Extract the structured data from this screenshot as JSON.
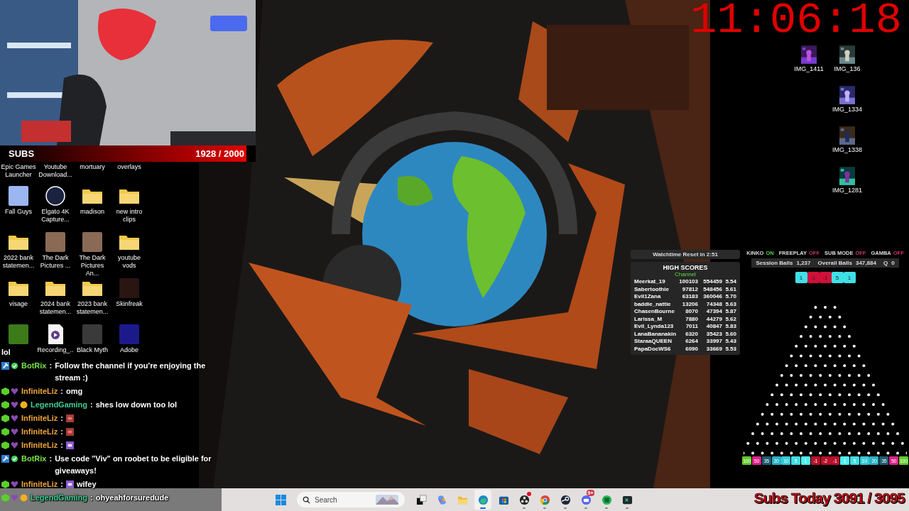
{
  "subs_goal": {
    "label": "SUBS",
    "count": "1928 / 2000",
    "level": 0.964
  },
  "desktop_icons": [
    {
      "label": "Epic Games Launcher",
      "kind": "hidden"
    },
    {
      "label": "Youtube Download...",
      "kind": "hidden"
    },
    {
      "label": "mortuary",
      "kind": "hidden"
    },
    {
      "label": "overlays",
      "kind": "hidden"
    },
    {
      "label": "Fall Guys",
      "kind": "app",
      "color": "#9bb6f0"
    },
    {
      "label": "Elgato 4K Capture...",
      "kind": "disc",
      "color": "#1a2340"
    },
    {
      "label": "madison",
      "kind": "folder"
    },
    {
      "label": "new intro clips",
      "kind": "folder"
    },
    {
      "label": "2022 bank statemen...",
      "kind": "folder"
    },
    {
      "label": "The Dark Pictures ...",
      "kind": "app",
      "color": "#8a6a55"
    },
    {
      "label": "The Dark Pictures An...",
      "kind": "app",
      "color": "#8a6a55"
    },
    {
      "label": "youtube vods",
      "kind": "folder"
    },
    {
      "label": "visage",
      "kind": "folder"
    },
    {
      "label": "2024 bank statemen...",
      "kind": "folder"
    },
    {
      "label": "2023 bank statemen...",
      "kind": "folder"
    },
    {
      "label": "Skinfreak",
      "kind": "app",
      "color": "#2a1512"
    },
    {
      "kind": "app",
      "color": "#3c7a1a"
    },
    {
      "label": "Recording_...",
      "kind": "file"
    },
    {
      "label": "Black Myth",
      "kind": "app",
      "color": "#3a3a3a"
    },
    {
      "label": "Adobe",
      "kind": "app",
      "color": "#1c1a8a"
    }
  ],
  "chat": [
    {
      "kind": "continuation",
      "message": "lol"
    },
    {
      "kind": "message",
      "user": "BotRix",
      "color": "#7be04a",
      "badges": [
        {
          "kind": "bot"
        },
        {
          "kind": "verified"
        }
      ],
      "separator": ":",
      "message": "Follow the channel if you're enjoying the stream :)"
    },
    {
      "kind": "message",
      "user": "InfiniteLiz",
      "color": "#f0a53a",
      "badges": [
        {
          "kind": "cube"
        },
        {
          "kind": "heart"
        }
      ],
      "separator": ":",
      "message": "omg"
    },
    {
      "kind": "message",
      "user": "LegendGaming",
      "color": "#3fcf95",
      "badges": [
        {
          "kind": "cube"
        },
        {
          "kind": "heart"
        },
        {
          "kind": "coin"
        }
      ],
      "separator": ":",
      "message": "shes low down too lol"
    },
    {
      "kind": "message",
      "user": "InfiniteLiz",
      "color": "#f0a53a",
      "badges": [
        {
          "kind": "cube"
        },
        {
          "kind": "heart"
        }
      ],
      "separator": ":",
      "emote": {
        "kind": "red"
      }
    },
    {
      "kind": "message",
      "user": "InfiniteLiz",
      "color": "#f0a53a",
      "badges": [
        {
          "kind": "cube"
        },
        {
          "kind": "heart"
        }
      ],
      "separator": ":",
      "emote": {
        "kind": "red"
      }
    },
    {
      "kind": "message",
      "user": "InfiniteLiz",
      "color": "#f0a53a",
      "badges": [
        {
          "kind": "cube"
        },
        {
          "kind": "heart"
        }
      ],
      "separator": ":",
      "emote": {
        "kind": "purple"
      }
    },
    {
      "kind": "message",
      "user": "BotRix",
      "color": "#7be04a",
      "badges": [
        {
          "kind": "bot"
        },
        {
          "kind": "verified"
        }
      ],
      "separator": ":",
      "message": "Use code \"Viv\" on roobet to be eligible for giveaways!"
    },
    {
      "kind": "message",
      "user": "InfiniteLiz",
      "color": "#f0a53a",
      "badges": [
        {
          "kind": "cube"
        },
        {
          "kind": "heart"
        }
      ],
      "separator": ":",
      "emote": {
        "kind": "purple"
      },
      "message": "wifey"
    },
    {
      "kind": "message",
      "user": "LegendGaming",
      "color": "#3fcf95",
      "badges": [
        {
          "kind": "cube"
        },
        {
          "kind": "heart"
        },
        {
          "kind": "coin"
        }
      ],
      "separator": ":",
      "message": "ohyeahforsuredude"
    }
  ],
  "clock": "11:06:18",
  "image_files": [
    "IMG_1411",
    "IMG_136",
    "IMG_1334",
    "IMG_1338",
    "IMG_1281"
  ],
  "watchtime": "Watchtime Reset in 2:51",
  "high_scores": {
    "title": "HIGH SCORES",
    "subtitle": "Channel",
    "rows": [
      {
        "name": "Meerkat_19",
        "score": "100103",
        "total": "554459",
        "avg": "5.54"
      },
      {
        "name": "Sabertoothie",
        "score": "97812",
        "total": "548456",
        "avg": "5.61"
      },
      {
        "name": "Evil1Zana",
        "score": "63183",
        "total": "360046",
        "avg": "5.70"
      },
      {
        "name": "baddie_nattie",
        "score": "13206",
        "total": "74348",
        "avg": "5.63"
      },
      {
        "name": "ChasenBourne",
        "score": "8070",
        "total": "47394",
        "avg": "5.87"
      },
      {
        "name": "Larissa_M",
        "score": "7880",
        "total": "44279",
        "avg": "5.62"
      },
      {
        "name": "Evil_Lynda123",
        "score": "7011",
        "total": "40847",
        "avg": "5.83"
      },
      {
        "name": "LanaBananakin",
        "score": "6320",
        "total": "35423",
        "avg": "5.60"
      },
      {
        "name": "StaraaQUEEN",
        "score": "6264",
        "total": "33997",
        "avg": "5.43"
      },
      {
        "name": "PapaDocWS6",
        "score": "6090",
        "total": "33669",
        "avg": "5.53"
      }
    ]
  },
  "plinko": {
    "toggles": [
      {
        "label": "KINKO",
        "status": "ON",
        "on": true
      },
      {
        "label": "FREEPLAY",
        "status": "OFF",
        "on": false
      },
      {
        "label": "SUB MODE",
        "status": "OFF",
        "on": false
      },
      {
        "label": "GAMBA",
        "status": "OFF",
        "on": false
      }
    ],
    "stats": [
      {
        "label": "Session Balls",
        "value": "1,237"
      },
      {
        "label": "Overall Balls",
        "value": "347,884"
      },
      {
        "label": "Q",
        "value": "0"
      }
    ],
    "recent": [
      {
        "value": "1",
        "color": "#3fe0e6"
      },
      {
        "value": "-1",
        "color": "#d0103a"
      },
      {
        "value": "-1",
        "color": "#d0103a"
      },
      {
        "value": "5",
        "color": "#3fe0e6"
      },
      {
        "value": "1",
        "color": "#3fe0e6"
      }
    ],
    "slots": [
      {
        "value": "100",
        "color": "#62c92a"
      },
      {
        "value": "50",
        "color": "#e0208a"
      },
      {
        "value": "35",
        "color": "#1e5d70"
      },
      {
        "value": "20",
        "color": "#2aafc4"
      },
      {
        "value": "10",
        "color": "#34c9d8"
      },
      {
        "value": "5",
        "color": "#3fdce2"
      },
      {
        "value": "1",
        "color": "#4ef0ee"
      },
      {
        "value": "-1",
        "color": "#b8102c"
      },
      {
        "value": "-2",
        "color": "#b8102c"
      },
      {
        "value": "-1",
        "color": "#b8102c"
      },
      {
        "value": "1",
        "color": "#4ef0ee"
      },
      {
        "value": "5",
        "color": "#3fdce2"
      },
      {
        "value": "10",
        "color": "#34c9d8"
      },
      {
        "value": "20",
        "color": "#2aafc4"
      },
      {
        "value": "35",
        "color": "#1e5d70"
      },
      {
        "value": "50",
        "color": "#e0208a"
      },
      {
        "value": "100",
        "color": "#62c92a"
      }
    ]
  },
  "taskbar": {
    "search_placeholder": "Search",
    "apps": [
      {
        "kind": "taskview",
        "selected": false,
        "running": false,
        "alert": false
      },
      {
        "kind": "copilot",
        "selected": false,
        "running": false,
        "alert": false
      },
      {
        "kind": "explorer",
        "selected": false,
        "running": false,
        "alert": false
      },
      {
        "kind": "edge",
        "selected": true,
        "running": true,
        "alert": false
      },
      {
        "kind": "store",
        "selected": false,
        "running": false,
        "alert": false
      },
      {
        "kind": "obs",
        "selected": false,
        "running": true,
        "alert": true
      },
      {
        "kind": "chrome",
        "selected": false,
        "running": true,
        "alert": false
      },
      {
        "kind": "steam",
        "selected": false,
        "running": true,
        "alert": false
      },
      {
        "kind": "discord",
        "selected": false,
        "running": true,
        "alert": false,
        "badge": "9+"
      },
      {
        "kind": "spotify",
        "selected": false,
        "running": true,
        "alert": false
      },
      {
        "kind": "terminal",
        "selected": false,
        "running": true,
        "alert": false
      }
    ]
  },
  "subs_today": {
    "label": "Subs Today",
    "count": "3091 / 3095"
  }
}
